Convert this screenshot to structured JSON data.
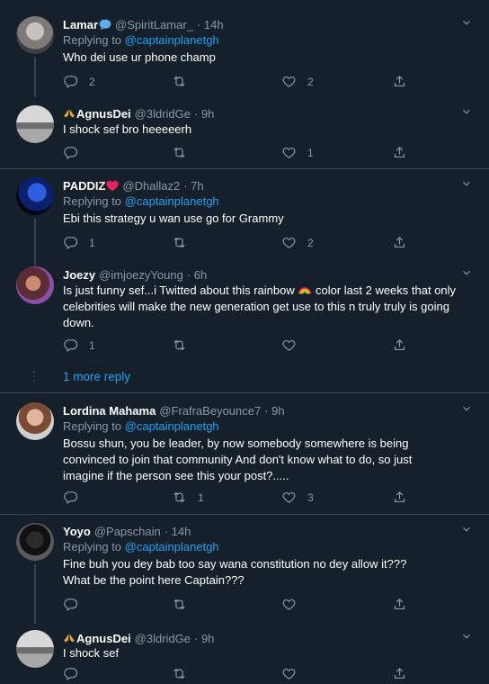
{
  "tweets": [
    {
      "name": "Lamar",
      "name_emoji": "speech-bubble-icon",
      "handle": "@SpiritLamar_",
      "time": "· 14h",
      "replying_prefix": "Replying to ",
      "replying_to": "@captainplanetgh",
      "text": "Who dei use ur phone champ",
      "replies": "2",
      "retweets": "",
      "likes": "2"
    },
    {
      "name": "AgnusDei",
      "name_prefix_emoji": "praying-hands-icon",
      "handle": "@3ldridGe",
      "time": "· 9h",
      "text": "I shock sef bro heeeeerh",
      "replies": "",
      "retweets": "",
      "likes": "1"
    },
    {
      "name": "PADDIZ",
      "name_emoji": "red-heart-icon",
      "handle": "@Dhallaz2",
      "time": "· 7h",
      "replying_prefix": "Replying to ",
      "replying_to": "@captainplanetgh",
      "text": "Ebi this strategy u wan use go for Grammy",
      "replies": "1",
      "retweets": "",
      "likes": "2"
    },
    {
      "name": "Joezy",
      "handle": "@imjoezyYoung",
      "time": "· 6h",
      "text_line1_a": "Is just funny sef...i Twitted about this rainbow",
      "text_line1_b": " color last 2 weeks that only",
      "text_line2": "celebrities will make the new generation get use to this n truly truly is going",
      "text_line3": "down.",
      "replies": "1",
      "retweets": "",
      "likes": ""
    },
    {
      "name": "Lordina Mahama",
      "handle": "@FrafraBeyounce7",
      "time": "· 9h",
      "replying_prefix": "Replying to ",
      "replying_to": "@captainplanetgh",
      "text_line1": "Bossu shun, you be leader, by now somebody somewhere is being",
      "text_line2": "convinced to join that community And don't know what to do, so just",
      "text_line3": "imagine if the person see this your post?.....",
      "replies": "",
      "retweets": "1",
      "likes": "3"
    },
    {
      "name": "Yoyo",
      "handle": "@Papschain",
      "time": "· 14h",
      "replying_prefix": "Replying to ",
      "replying_to": "@captainplanetgh",
      "text_line1": "Fine buh you dey bab too say wana constitution no dey allow it???",
      "text_line2": "What be the point here Captain???",
      "replies": "",
      "retweets": "",
      "likes": ""
    },
    {
      "name": "AgnusDei",
      "name_prefix_emoji": "praying-hands-icon",
      "handle": "@3ldridGe",
      "time": "· 9h",
      "text": "I shock sef",
      "replies": "",
      "retweets": "",
      "likes": ""
    }
  ],
  "more_replies": "1 more reply",
  "colors": {
    "background": "#15202b",
    "divider": "#38444d",
    "secondary_text": "#8899a6",
    "link": "#1da1f2"
  }
}
